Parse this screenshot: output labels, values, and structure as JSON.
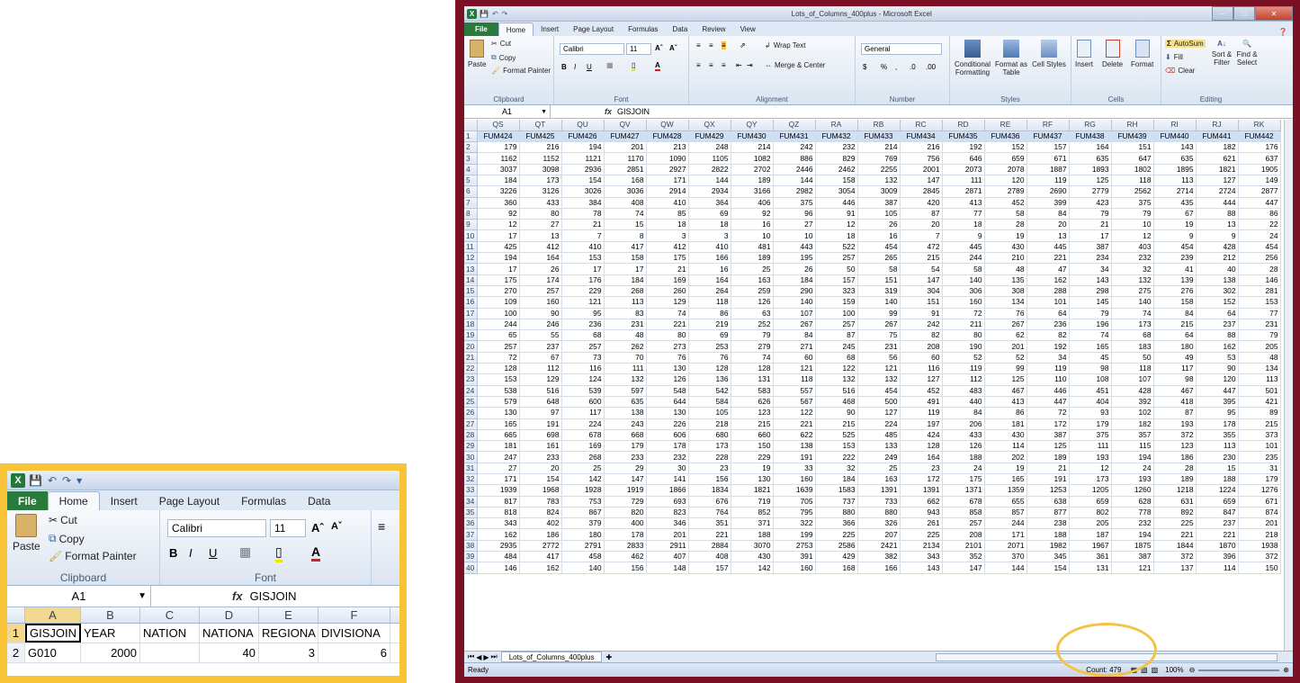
{
  "colors": {
    "frame": "#7a1024",
    "zoom_frame": "#f7c437",
    "file_tab": "#2b7a3d",
    "highlight": "#f5c343"
  },
  "zoom": {
    "tabs": [
      "File",
      "Home",
      "Insert",
      "Page Layout",
      "Formulas",
      "Data"
    ],
    "clipboard": {
      "paste": "Paste",
      "cut": "Cut",
      "copy": "Copy",
      "format_painter": "Format Painter",
      "label": "Clipboard"
    },
    "font": {
      "name": "Calibri",
      "size": "11",
      "label": "Font",
      "bold": "B",
      "italic": "I",
      "underline": "U"
    },
    "namebox": "A1",
    "fx": "fx",
    "formula": "GISJOIN",
    "columns": [
      "A",
      "B",
      "C",
      "D",
      "E",
      "F"
    ],
    "row1": [
      "1",
      "GISJOIN",
      "YEAR",
      "NATION",
      "NATIONA",
      "REGIONA",
      "DIVISIONA"
    ],
    "row2": [
      "2",
      "G010",
      "2000",
      "",
      "40",
      "3",
      "6"
    ]
  },
  "main": {
    "title": "Lots_of_Columns_400plus - Microsoft Excel",
    "tabs": [
      "File",
      "Home",
      "Insert",
      "Page Layout",
      "Formulas",
      "Data",
      "Review",
      "View"
    ],
    "ribbon": {
      "paste": "Paste",
      "cut": "Cut",
      "copy": "Copy",
      "format_painter": "Format Painter",
      "clipboard": "Clipboard",
      "font_name": "Calibri",
      "font_size": "11",
      "font": "Font",
      "wrap_text": "Wrap Text",
      "merge_center": "Merge & Center",
      "alignment": "Alignment",
      "number_format": "General",
      "number": "Number",
      "conditional": "Conditional Formatting",
      "format_table": "Format as Table",
      "cell_styles": "Cell Styles",
      "styles": "Styles",
      "insert": "Insert",
      "delete": "Delete",
      "format": "Format",
      "cells": "Cells",
      "autosum": "AutoSum",
      "fill": "Fill",
      "clear": "Clear",
      "sort_filter": "Sort & Filter",
      "find_select": "Find & Select",
      "editing": "Editing"
    },
    "namebox": "A1",
    "fx": "fx",
    "formula": "GISJOIN",
    "sheet_tab": "Lots_of_Columns_400plus",
    "status_ready": "Ready",
    "status_count": "Count: 479",
    "zoom_level": "100%",
    "columns": [
      "QS",
      "QT",
      "QU",
      "QV",
      "QW",
      "QX",
      "QY",
      "QZ",
      "RA",
      "RB",
      "RC",
      "RD",
      "RE",
      "RF",
      "RG",
      "RH",
      "RI",
      "RJ",
      "RK"
    ],
    "rows": [
      [
        "FUM424",
        "FUM425",
        "FUM426",
        "FUM427",
        "FUM428",
        "FUM429",
        "FUM430",
        "FUM431",
        "FUM432",
        "FUM433",
        "FUM434",
        "FUM435",
        "FUM436",
        "FUM437",
        "FUM438",
        "FUM439",
        "FUM440",
        "FUM441",
        "FUM442"
      ],
      [
        "179",
        "216",
        "194",
        "201",
        "213",
        "248",
        "214",
        "242",
        "232",
        "214",
        "216",
        "192",
        "152",
        "157",
        "164",
        "151",
        "143",
        "182",
        "176"
      ],
      [
        "1162",
        "1152",
        "1121",
        "1170",
        "1090",
        "1105",
        "1082",
        "886",
        "829",
        "769",
        "756",
        "646",
        "659",
        "671",
        "635",
        "647",
        "635",
        "621",
        "637"
      ],
      [
        "3037",
        "3098",
        "2936",
        "2851",
        "2927",
        "2822",
        "2702",
        "2446",
        "2462",
        "2255",
        "2001",
        "2073",
        "2078",
        "1887",
        "1893",
        "1802",
        "1895",
        "1821",
        "1905"
      ],
      [
        "184",
        "173",
        "154",
        "168",
        "171",
        "144",
        "189",
        "144",
        "158",
        "132",
        "147",
        "111",
        "120",
        "119",
        "125",
        "118",
        "113",
        "127",
        "149"
      ],
      [
        "3226",
        "3126",
        "3026",
        "3036",
        "2914",
        "2934",
        "3166",
        "2982",
        "3054",
        "3009",
        "2845",
        "2871",
        "2789",
        "2690",
        "2779",
        "2562",
        "2714",
        "2724",
        "2877"
      ],
      [
        "360",
        "433",
        "384",
        "408",
        "410",
        "364",
        "406",
        "375",
        "446",
        "387",
        "420",
        "413",
        "452",
        "399",
        "423",
        "375",
        "435",
        "444",
        "447"
      ],
      [
        "92",
        "80",
        "78",
        "74",
        "85",
        "69",
        "92",
        "96",
        "91",
        "105",
        "87",
        "77",
        "58",
        "84",
        "79",
        "79",
        "67",
        "88",
        "86"
      ],
      [
        "12",
        "27",
        "21",
        "15",
        "18",
        "18",
        "16",
        "27",
        "12",
        "26",
        "20",
        "18",
        "28",
        "20",
        "21",
        "10",
        "19",
        "13",
        "22"
      ],
      [
        "17",
        "13",
        "7",
        "8",
        "3",
        "3",
        "10",
        "10",
        "18",
        "16",
        "7",
        "9",
        "19",
        "13",
        "17",
        "12",
        "9",
        "9",
        "24"
      ],
      [
        "425",
        "412",
        "410",
        "417",
        "412",
        "410",
        "481",
        "443",
        "522",
        "454",
        "472",
        "445",
        "430",
        "445",
        "387",
        "403",
        "454",
        "428",
        "454"
      ],
      [
        "194",
        "164",
        "153",
        "158",
        "175",
        "166",
        "189",
        "195",
        "257",
        "265",
        "215",
        "244",
        "210",
        "221",
        "234",
        "232",
        "239",
        "212",
        "256"
      ],
      [
        "17",
        "26",
        "17",
        "17",
        "21",
        "16",
        "25",
        "26",
        "50",
        "58",
        "54",
        "58",
        "48",
        "47",
        "34",
        "32",
        "41",
        "40",
        "28"
      ],
      [
        "175",
        "174",
        "176",
        "184",
        "169",
        "164",
        "163",
        "184",
        "157",
        "151",
        "147",
        "140",
        "135",
        "162",
        "143",
        "132",
        "139",
        "138",
        "146"
      ],
      [
        "270",
        "257",
        "229",
        "268",
        "260",
        "264",
        "259",
        "290",
        "323",
        "319",
        "304",
        "306",
        "308",
        "288",
        "298",
        "275",
        "276",
        "302",
        "281"
      ],
      [
        "109",
        "160",
        "121",
        "113",
        "129",
        "118",
        "126",
        "140",
        "159",
        "140",
        "151",
        "160",
        "134",
        "101",
        "145",
        "140",
        "158",
        "152",
        "153"
      ],
      [
        "100",
        "90",
        "95",
        "83",
        "74",
        "86",
        "63",
        "107",
        "100",
        "99",
        "91",
        "72",
        "76",
        "64",
        "79",
        "74",
        "84",
        "64",
        "77"
      ],
      [
        "244",
        "246",
        "236",
        "231",
        "221",
        "219",
        "252",
        "267",
        "257",
        "267",
        "242",
        "211",
        "267",
        "236",
        "196",
        "173",
        "215",
        "237",
        "231"
      ],
      [
        "65",
        "55",
        "68",
        "48",
        "80",
        "69",
        "79",
        "84",
        "87",
        "75",
        "82",
        "80",
        "62",
        "82",
        "74",
        "68",
        "64",
        "88",
        "79"
      ],
      [
        "257",
        "237",
        "257",
        "262",
        "273",
        "253",
        "279",
        "271",
        "245",
        "231",
        "208",
        "190",
        "201",
        "192",
        "165",
        "183",
        "180",
        "162",
        "205"
      ],
      [
        "72",
        "67",
        "73",
        "70",
        "76",
        "76",
        "74",
        "60",
        "68",
        "56",
        "60",
        "52",
        "52",
        "34",
        "45",
        "50",
        "49",
        "53",
        "48"
      ],
      [
        "128",
        "112",
        "116",
        "111",
        "130",
        "128",
        "128",
        "121",
        "122",
        "121",
        "116",
        "119",
        "99",
        "119",
        "98",
        "118",
        "117",
        "90",
        "134"
      ],
      [
        "153",
        "129",
        "124",
        "132",
        "126",
        "136",
        "131",
        "118",
        "132",
        "132",
        "127",
        "112",
        "125",
        "110",
        "108",
        "107",
        "98",
        "120",
        "113"
      ],
      [
        "538",
        "516",
        "539",
        "597",
        "548",
        "542",
        "583",
        "557",
        "516",
        "454",
        "452",
        "483",
        "467",
        "446",
        "451",
        "428",
        "467",
        "447",
        "501"
      ],
      [
        "579",
        "648",
        "600",
        "635",
        "644",
        "584",
        "626",
        "567",
        "468",
        "500",
        "491",
        "440",
        "413",
        "447",
        "404",
        "392",
        "418",
        "395",
        "421"
      ],
      [
        "130",
        "97",
        "117",
        "138",
        "130",
        "105",
        "123",
        "122",
        "90",
        "127",
        "119",
        "84",
        "86",
        "72",
        "93",
        "102",
        "87",
        "95",
        "89"
      ],
      [
        "165",
        "191",
        "224",
        "243",
        "226",
        "218",
        "215",
        "221",
        "215",
        "224",
        "197",
        "206",
        "181",
        "172",
        "179",
        "182",
        "193",
        "178",
        "215"
      ],
      [
        "665",
        "698",
        "678",
        "668",
        "606",
        "680",
        "660",
        "622",
        "525",
        "485",
        "424",
        "433",
        "430",
        "387",
        "375",
        "357",
        "372",
        "355",
        "373"
      ],
      [
        "181",
        "161",
        "169",
        "179",
        "178",
        "173",
        "150",
        "138",
        "153",
        "133",
        "128",
        "126",
        "114",
        "125",
        "111",
        "115",
        "123",
        "113",
        "101"
      ],
      [
        "247",
        "233",
        "268",
        "233",
        "232",
        "228",
        "229",
        "191",
        "222",
        "249",
        "164",
        "188",
        "202",
        "189",
        "193",
        "194",
        "186",
        "230",
        "235"
      ],
      [
        "27",
        "20",
        "25",
        "29",
        "30",
        "23",
        "19",
        "33",
        "32",
        "25",
        "23",
        "24",
        "19",
        "21",
        "12",
        "24",
        "28",
        "15",
        "31"
      ],
      [
        "171",
        "154",
        "142",
        "147",
        "141",
        "156",
        "130",
        "160",
        "184",
        "163",
        "172",
        "175",
        "165",
        "191",
        "173",
        "193",
        "189",
        "188",
        "179"
      ],
      [
        "1939",
        "1968",
        "1928",
        "1919",
        "1866",
        "1834",
        "1821",
        "1639",
        "1583",
        "1391",
        "1391",
        "1371",
        "1359",
        "1253",
        "1205",
        "1260",
        "1218",
        "1224",
        "1276"
      ],
      [
        "817",
        "783",
        "753",
        "729",
        "693",
        "676",
        "719",
        "705",
        "737",
        "733",
        "662",
        "678",
        "655",
        "638",
        "659",
        "628",
        "631",
        "659",
        "671"
      ],
      [
        "818",
        "824",
        "867",
        "820",
        "823",
        "764",
        "852",
        "795",
        "880",
        "880",
        "943",
        "858",
        "857",
        "877",
        "802",
        "778",
        "892",
        "847",
        "874"
      ],
      [
        "343",
        "402",
        "379",
        "400",
        "346",
        "351",
        "371",
        "322",
        "366",
        "326",
        "261",
        "257",
        "244",
        "238",
        "205",
        "232",
        "225",
        "237",
        "201"
      ],
      [
        "162",
        "186",
        "180",
        "178",
        "201",
        "221",
        "188",
        "199",
        "225",
        "207",
        "225",
        "208",
        "171",
        "188",
        "187",
        "194",
        "221",
        "221",
        "218"
      ],
      [
        "2935",
        "2772",
        "2791",
        "2833",
        "2911",
        "2884",
        "3070",
        "2753",
        "2586",
        "2421",
        "2134",
        "2101",
        "2071",
        "1982",
        "1967",
        "1875",
        "1844",
        "1870",
        "1938"
      ],
      [
        "484",
        "417",
        "458",
        "462",
        "407",
        "408",
        "430",
        "391",
        "429",
        "382",
        "343",
        "352",
        "370",
        "345",
        "361",
        "387",
        "372",
        "396",
        "372"
      ],
      [
        "146",
        "162",
        "140",
        "156",
        "148",
        "157",
        "142",
        "160",
        "168",
        "166",
        "143",
        "147",
        "144",
        "154",
        "131",
        "121",
        "137",
        "114",
        "150"
      ]
    ]
  }
}
